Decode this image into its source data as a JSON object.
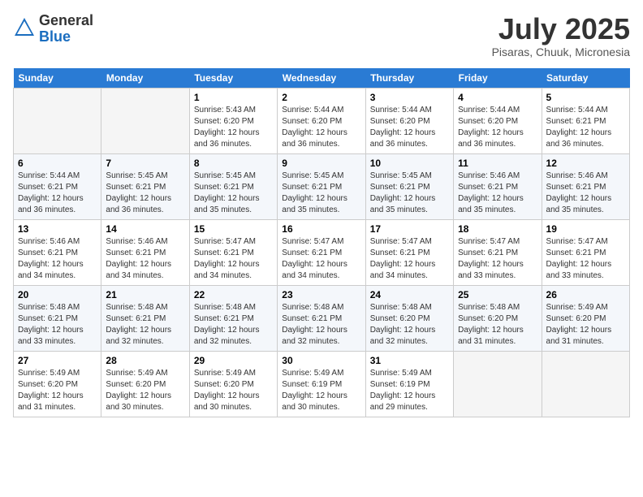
{
  "header": {
    "logo_general": "General",
    "logo_blue": "Blue",
    "month_title": "July 2025",
    "location": "Pisaras, Chuuk, Micronesia"
  },
  "days_of_week": [
    "Sunday",
    "Monday",
    "Tuesday",
    "Wednesday",
    "Thursday",
    "Friday",
    "Saturday"
  ],
  "weeks": [
    [
      {
        "day": "",
        "empty": true
      },
      {
        "day": "",
        "empty": true
      },
      {
        "day": "1",
        "sunrise": "Sunrise: 5:43 AM",
        "sunset": "Sunset: 6:20 PM",
        "daylight": "Daylight: 12 hours and 36 minutes."
      },
      {
        "day": "2",
        "sunrise": "Sunrise: 5:44 AM",
        "sunset": "Sunset: 6:20 PM",
        "daylight": "Daylight: 12 hours and 36 minutes."
      },
      {
        "day": "3",
        "sunrise": "Sunrise: 5:44 AM",
        "sunset": "Sunset: 6:20 PM",
        "daylight": "Daylight: 12 hours and 36 minutes."
      },
      {
        "day": "4",
        "sunrise": "Sunrise: 5:44 AM",
        "sunset": "Sunset: 6:20 PM",
        "daylight": "Daylight: 12 hours and 36 minutes."
      },
      {
        "day": "5",
        "sunrise": "Sunrise: 5:44 AM",
        "sunset": "Sunset: 6:21 PM",
        "daylight": "Daylight: 12 hours and 36 minutes."
      }
    ],
    [
      {
        "day": "6",
        "sunrise": "Sunrise: 5:44 AM",
        "sunset": "Sunset: 6:21 PM",
        "daylight": "Daylight: 12 hours and 36 minutes."
      },
      {
        "day": "7",
        "sunrise": "Sunrise: 5:45 AM",
        "sunset": "Sunset: 6:21 PM",
        "daylight": "Daylight: 12 hours and 36 minutes."
      },
      {
        "day": "8",
        "sunrise": "Sunrise: 5:45 AM",
        "sunset": "Sunset: 6:21 PM",
        "daylight": "Daylight: 12 hours and 35 minutes."
      },
      {
        "day": "9",
        "sunrise": "Sunrise: 5:45 AM",
        "sunset": "Sunset: 6:21 PM",
        "daylight": "Daylight: 12 hours and 35 minutes."
      },
      {
        "day": "10",
        "sunrise": "Sunrise: 5:45 AM",
        "sunset": "Sunset: 6:21 PM",
        "daylight": "Daylight: 12 hours and 35 minutes."
      },
      {
        "day": "11",
        "sunrise": "Sunrise: 5:46 AM",
        "sunset": "Sunset: 6:21 PM",
        "daylight": "Daylight: 12 hours and 35 minutes."
      },
      {
        "day": "12",
        "sunrise": "Sunrise: 5:46 AM",
        "sunset": "Sunset: 6:21 PM",
        "daylight": "Daylight: 12 hours and 35 minutes."
      }
    ],
    [
      {
        "day": "13",
        "sunrise": "Sunrise: 5:46 AM",
        "sunset": "Sunset: 6:21 PM",
        "daylight": "Daylight: 12 hours and 34 minutes."
      },
      {
        "day": "14",
        "sunrise": "Sunrise: 5:46 AM",
        "sunset": "Sunset: 6:21 PM",
        "daylight": "Daylight: 12 hours and 34 minutes."
      },
      {
        "day": "15",
        "sunrise": "Sunrise: 5:47 AM",
        "sunset": "Sunset: 6:21 PM",
        "daylight": "Daylight: 12 hours and 34 minutes."
      },
      {
        "day": "16",
        "sunrise": "Sunrise: 5:47 AM",
        "sunset": "Sunset: 6:21 PM",
        "daylight": "Daylight: 12 hours and 34 minutes."
      },
      {
        "day": "17",
        "sunrise": "Sunrise: 5:47 AM",
        "sunset": "Sunset: 6:21 PM",
        "daylight": "Daylight: 12 hours and 34 minutes."
      },
      {
        "day": "18",
        "sunrise": "Sunrise: 5:47 AM",
        "sunset": "Sunset: 6:21 PM",
        "daylight": "Daylight: 12 hours and 33 minutes."
      },
      {
        "day": "19",
        "sunrise": "Sunrise: 5:47 AM",
        "sunset": "Sunset: 6:21 PM",
        "daylight": "Daylight: 12 hours and 33 minutes."
      }
    ],
    [
      {
        "day": "20",
        "sunrise": "Sunrise: 5:48 AM",
        "sunset": "Sunset: 6:21 PM",
        "daylight": "Daylight: 12 hours and 33 minutes."
      },
      {
        "day": "21",
        "sunrise": "Sunrise: 5:48 AM",
        "sunset": "Sunset: 6:21 PM",
        "daylight": "Daylight: 12 hours and 32 minutes."
      },
      {
        "day": "22",
        "sunrise": "Sunrise: 5:48 AM",
        "sunset": "Sunset: 6:21 PM",
        "daylight": "Daylight: 12 hours and 32 minutes."
      },
      {
        "day": "23",
        "sunrise": "Sunrise: 5:48 AM",
        "sunset": "Sunset: 6:21 PM",
        "daylight": "Daylight: 12 hours and 32 minutes."
      },
      {
        "day": "24",
        "sunrise": "Sunrise: 5:48 AM",
        "sunset": "Sunset: 6:20 PM",
        "daylight": "Daylight: 12 hours and 32 minutes."
      },
      {
        "day": "25",
        "sunrise": "Sunrise: 5:48 AM",
        "sunset": "Sunset: 6:20 PM",
        "daylight": "Daylight: 12 hours and 31 minutes."
      },
      {
        "day": "26",
        "sunrise": "Sunrise: 5:49 AM",
        "sunset": "Sunset: 6:20 PM",
        "daylight": "Daylight: 12 hours and 31 minutes."
      }
    ],
    [
      {
        "day": "27",
        "sunrise": "Sunrise: 5:49 AM",
        "sunset": "Sunset: 6:20 PM",
        "daylight": "Daylight: 12 hours and 31 minutes."
      },
      {
        "day": "28",
        "sunrise": "Sunrise: 5:49 AM",
        "sunset": "Sunset: 6:20 PM",
        "daylight": "Daylight: 12 hours and 30 minutes."
      },
      {
        "day": "29",
        "sunrise": "Sunrise: 5:49 AM",
        "sunset": "Sunset: 6:20 PM",
        "daylight": "Daylight: 12 hours and 30 minutes."
      },
      {
        "day": "30",
        "sunrise": "Sunrise: 5:49 AM",
        "sunset": "Sunset: 6:19 PM",
        "daylight": "Daylight: 12 hours and 30 minutes."
      },
      {
        "day": "31",
        "sunrise": "Sunrise: 5:49 AM",
        "sunset": "Sunset: 6:19 PM",
        "daylight": "Daylight: 12 hours and 29 minutes."
      },
      {
        "day": "",
        "empty": true
      },
      {
        "day": "",
        "empty": true
      }
    ]
  ]
}
